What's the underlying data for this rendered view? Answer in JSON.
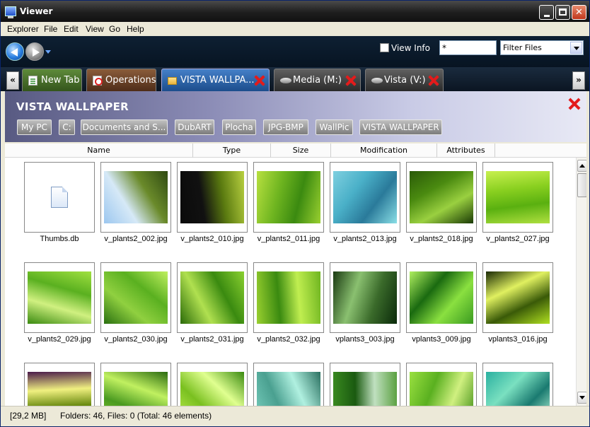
{
  "window": {
    "title": "Viewer"
  },
  "menu": [
    "Explorer",
    "File",
    "Edit",
    "View",
    "Go",
    "Help"
  ],
  "toolbar": {
    "view_info_label": "View Info",
    "view_info_checked": false,
    "filter_value": "*",
    "filter_select": "Filter Files"
  },
  "tabs": [
    {
      "label": "New Tab",
      "icon": "document-icon",
      "closable": false
    },
    {
      "label": "Operations",
      "icon": "operations-icon",
      "closable": false
    },
    {
      "label": "VISTA WALLPA...",
      "icon": "folder-icon",
      "closable": true,
      "active": true
    },
    {
      "label": "Media (M:)",
      "icon": "drive-icon",
      "closable": true
    },
    {
      "label": "Vista (V:)",
      "icon": "drive-icon",
      "closable": true
    }
  ],
  "tab_scroll": {
    "left": "«",
    "right": "»"
  },
  "path": {
    "title": "VISTA WALLPAPER",
    "crumbs": [
      "My PC",
      "C:",
      "Documents and S...",
      "DubART",
      "Plocha",
      "JPG-BMP",
      "WallPic",
      "VISTA WALLPAPER"
    ]
  },
  "columns": [
    "Name",
    "Type",
    "Size",
    "Modification",
    "Attributes"
  ],
  "files": [
    {
      "name": "Thumbs.db",
      "kind": "doc"
    },
    {
      "name": "v_plants2_002.jpg",
      "colors": [
        "#9cc7ef",
        "#d6e9f7",
        "#6a8a2a",
        "#2f4a12"
      ]
    },
    {
      "name": "v_plants2_010.jpg",
      "colors": [
        "#0a0a0a",
        "#111",
        "#5a7a10",
        "#b8d040"
      ]
    },
    {
      "name": "v_plants2_011.jpg",
      "colors": [
        "#b8e040",
        "#6fb520",
        "#3b8a10",
        "#9ad030"
      ]
    },
    {
      "name": "v_plants2_013.jpg",
      "colors": [
        "#7fd0e0",
        "#4ab0c8",
        "#2a7a9a",
        "#8adfe6"
      ]
    },
    {
      "name": "v_plants2_018.jpg",
      "colors": [
        "#2a5a08",
        "#4a8a10",
        "#9ad040",
        "#1a3a05"
      ]
    },
    {
      "name": "v_plants2_027.jpg",
      "colors": [
        "#c8f050",
        "#8ad020",
        "#5ab010",
        "#b0e040"
      ]
    },
    {
      "name": "v_plants2_029.jpg",
      "colors": [
        "#a0e040",
        "#5ab020",
        "#d0f080",
        "#3a8a10"
      ]
    },
    {
      "name": "v_plants2_030.jpg",
      "colors": [
        "#c0f060",
        "#5ab020",
        "#90d040",
        "#2a7010"
      ]
    },
    {
      "name": "v_plants2_031.jpg",
      "colors": [
        "#8ad030",
        "#3a8a10",
        "#b0e050",
        "#2a6a08"
      ]
    },
    {
      "name": "v_plants2_032.jpg",
      "colors": [
        "#6fb520",
        "#c0ee50",
        "#3a8a10",
        "#9ad030"
      ]
    },
    {
      "name": "vplants3_003.jpg",
      "colors": [
        "#0a2a0a",
        "#3a6a2a",
        "#8ac070",
        "#1a3a12"
      ]
    },
    {
      "name": "vplants3_009.jpg",
      "colors": [
        "#3a9a20",
        "#8ae040",
        "#1a6a10",
        "#b0f060"
      ]
    },
    {
      "name": "vplants3_016.jpg",
      "colors": [
        "#b0e020",
        "#3a5a08",
        "#e0f060",
        "#1a2a05"
      ]
    },
    {
      "name": "",
      "colors": [
        "#c0e030",
        "#6a8a10",
        "#f0f080",
        "#4a1a4a"
      ]
    },
    {
      "name": "",
      "colors": [
        "#8ad030",
        "#4a9a20",
        "#c0f060",
        "#2a6a10"
      ]
    },
    {
      "name": "",
      "colors": [
        "#c0f050",
        "#7ac020",
        "#e0ff90",
        "#3a8a10"
      ]
    },
    {
      "name": "",
      "colors": [
        "#7ad0c0",
        "#4aa090",
        "#b0f0e0",
        "#2a7060"
      ]
    },
    {
      "name": "",
      "colors": [
        "#3a8a20",
        "#1a5a10",
        "#c0e0c0",
        "#5aa040"
      ]
    },
    {
      "name": "",
      "colors": [
        "#9ae040",
        "#5ab020",
        "#d0f080",
        "#3a8a10"
      ]
    },
    {
      "name": "",
      "colors": [
        "#2ab0a0",
        "#7ae0c0",
        "#1a7a70",
        "#c0ffe0"
      ]
    }
  ],
  "status": {
    "size": "[29,2 MB]",
    "summary": "Folders: 46, Files: 0  (Total: 46 elements)"
  }
}
